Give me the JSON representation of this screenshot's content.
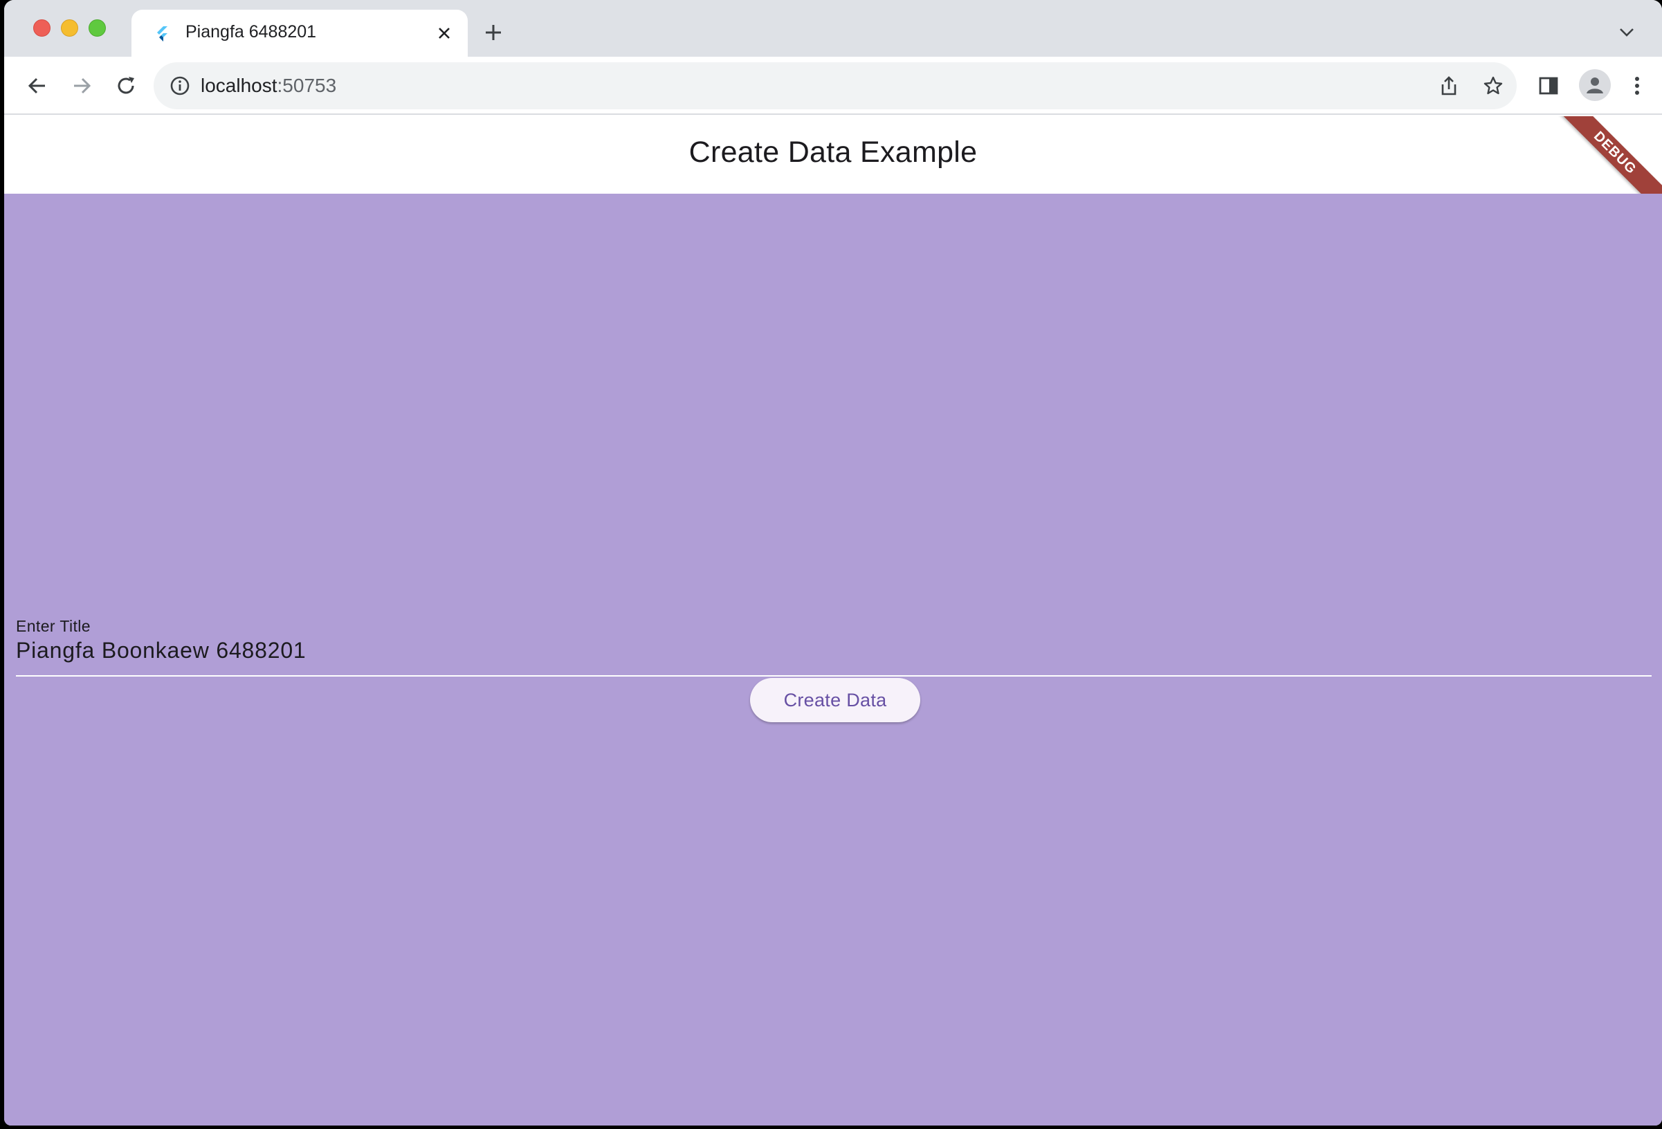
{
  "browser": {
    "tab": {
      "title": "Piangfa 6488201"
    },
    "url": {
      "host": "localhost",
      "port": ":50753"
    }
  },
  "app": {
    "title": "Create Data Example",
    "debug_banner": "DEBUG",
    "field": {
      "label": "Enter Title",
      "value": "Piangfa Boonkaew 6488201"
    },
    "button": {
      "label": "Create Data"
    }
  },
  "colors": {
    "body_background": "#b09ed6",
    "button_text": "#6750a4",
    "debug_banner": "#a0413a"
  }
}
